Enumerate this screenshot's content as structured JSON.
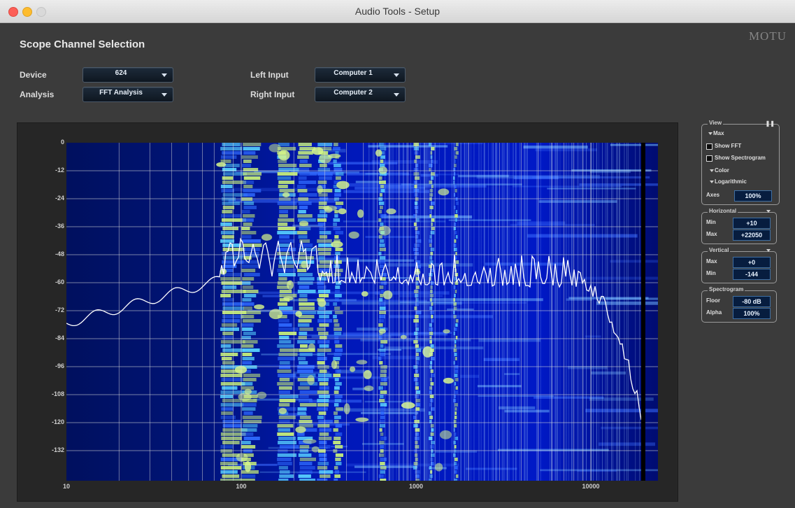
{
  "window": {
    "title": "Audio Tools - Setup",
    "brand": "MOTU"
  },
  "header": {
    "section_title": "Scope Channel Selection"
  },
  "controls": {
    "device_label": "Device",
    "device_value": "624",
    "analysis_label": "Analysis",
    "analysis_value": "FFT Analysis",
    "left_input_label": "Left Input",
    "left_input_value": "Computer 1",
    "right_input_label": "Right Input",
    "right_input_value": "Computer 2"
  },
  "plot": {
    "y_ticks": [
      "0",
      "-12",
      "-24",
      "-36",
      "-48",
      "-60",
      "-72",
      "-84",
      "-96",
      "-108",
      "-120",
      "-132"
    ],
    "x_ticks": [
      "10",
      "100",
      "1000",
      "10000"
    ]
  },
  "side": {
    "view": {
      "title": "View",
      "max_label": "Max",
      "show_fft": "Show FFT",
      "show_spectrogram": "Show Spectrogram",
      "color_label": "Color",
      "logarithmic_label": "Logarithmic",
      "axes_label": "Axes",
      "axes_value": "100%"
    },
    "horizontal": {
      "title": "Horizontal",
      "min_label": "Min",
      "min_value": "+10",
      "max_label": "Max",
      "max_value": "+22050"
    },
    "vertical": {
      "title": "Vertical",
      "max_label": "Max",
      "max_value": "+0",
      "min_label": "Min",
      "min_value": "-144"
    },
    "spectrogram": {
      "title": "Spectrogram",
      "floor_label": "Floor",
      "floor_value": "-80 dB",
      "alpha_label": "Alpha",
      "alpha_value": "100%"
    }
  },
  "colors": {
    "spectrogram_base": "#0015a8",
    "spectrogram_hot": "#c8f07a",
    "fft_line": "#ffffff",
    "field_bg": "#071d3f"
  }
}
